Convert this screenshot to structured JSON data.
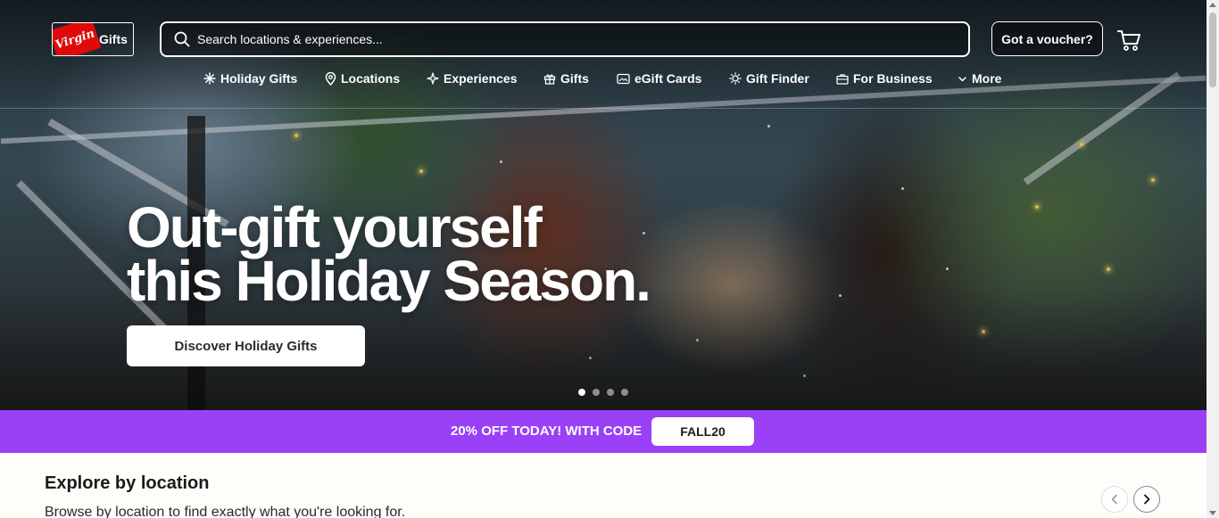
{
  "brand": {
    "logo_script": "Virgin",
    "logo_word": "Gifts",
    "accent_red": "#e10a0a",
    "promo_purple": "#9a40f7"
  },
  "header": {
    "search_placeholder": "Search locations & experiences...",
    "voucher_label": "Got a voucher?",
    "cart_icon": "cart-icon"
  },
  "nav": {
    "items": [
      {
        "label": "Holiday Gifts",
        "icon": "snowflake-icon"
      },
      {
        "label": "Locations",
        "icon": "location-pin-icon"
      },
      {
        "label": "Experiences",
        "icon": "sparkle-icon"
      },
      {
        "label": "Gifts",
        "icon": "gift-icon"
      },
      {
        "label": "eGift Cards",
        "icon": "card-icon"
      },
      {
        "label": "Gift Finder",
        "icon": "sun-icon"
      },
      {
        "label": "For Business",
        "icon": "briefcase-icon"
      },
      {
        "label": "More",
        "icon": "chevron-down-icon"
      }
    ]
  },
  "hero": {
    "headline_line1": "Out-gift yourself",
    "headline_line2": "this Holiday Season.",
    "cta_label": "Discover Holiday Gifts",
    "carousel_slides": 4,
    "carousel_active": 1
  },
  "promo": {
    "text": "20% OFF TODAY! WITH CODE",
    "code": "FALL20"
  },
  "explore": {
    "title": "Explore by location",
    "subtitle": "Browse by location to find exactly what you're looking for."
  }
}
